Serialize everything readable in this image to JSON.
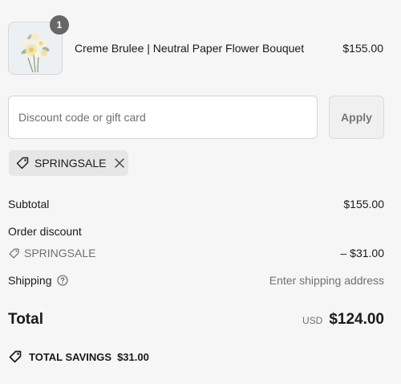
{
  "product": {
    "name": "Creme Brulee | Neutral Paper Flower Bouquet",
    "price": "$155.00",
    "quantity": "1",
    "image": "flower-bouquet-image"
  },
  "discount": {
    "placeholder": "Discount code or gift card",
    "apply_label": "Apply",
    "applied_code": "SPRINGSALE"
  },
  "summary": {
    "subtotal_label": "Subtotal",
    "subtotal_value": "$155.00",
    "order_discount_label": "Order discount",
    "discount_code": "SPRINGSALE",
    "discount_value": "– $31.00",
    "shipping_label": "Shipping",
    "shipping_value": "Enter shipping address",
    "total_label": "Total",
    "currency": "USD",
    "total_value": "$124.00",
    "savings_label": "TOTAL SAVINGS",
    "savings_value": "$31.00"
  },
  "icons": {
    "tag": "tag-icon",
    "remove": "close-icon",
    "help": "help-circle-icon"
  },
  "colors": {
    "background": "#f6f6f6",
    "badge": "#666666",
    "muted_text": "#707070",
    "tag_background": "#e6e6e6"
  }
}
